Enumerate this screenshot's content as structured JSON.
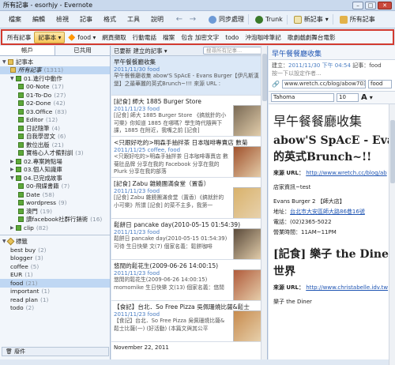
{
  "window": {
    "title": "所有記事 - esorhjy - Evernote"
  },
  "menu": {
    "items": [
      "檔案",
      "編輯",
      "檢視",
      "記事",
      "格式",
      "工具",
      "說明"
    ]
  },
  "toolbar": {
    "sync": "同步處理",
    "trunk": "Trunk",
    "new_note": "新記事",
    "all_notes": "所有記事"
  },
  "tag_filter": {
    "items": [
      "所有記事",
      "記事本",
      "food",
      "網頁擷取",
      "行動電話",
      "檔案",
      "包含 加密文字",
      "todo",
      "沖泡咖啡筆記",
      "歌劇戲劇舞台電影"
    ],
    "selected": "記事本"
  },
  "sidebar": {
    "tabs": [
      "帳戶",
      "已共用"
    ],
    "notebooks_header": "記事本",
    "all_notes": "所有記事",
    "all_count": "(1311)",
    "items": [
      {
        "label": "01.進行中動作",
        "level": 0,
        "expand": "▼"
      },
      {
        "label": "00-Note",
        "count": "(17)",
        "level": 1
      },
      {
        "label": "01-To-Do",
        "count": "(27)",
        "level": 1
      },
      {
        "label": "02-Done",
        "count": "(42)",
        "level": 1
      },
      {
        "label": "03.Office",
        "count": "(83)",
        "level": 1
      },
      {
        "label": "Editor",
        "count": "(12)",
        "level": 1
      },
      {
        "label": "日記隨筆",
        "count": "(4)",
        "level": 1
      },
      {
        "label": "自我學習文",
        "count": "(6)",
        "level": 1
      },
      {
        "label": "數位出版",
        "count": "(21)",
        "level": 1
      },
      {
        "label": "寶格心人才備對訓",
        "count": "(3)",
        "level": 1
      },
      {
        "label": "02.專案跨點場",
        "level": 0,
        "expand": "▶"
      },
      {
        "label": "03.個人知識庫",
        "level": 0,
        "expand": "▶"
      },
      {
        "label": "04.已完成故事",
        "level": 0,
        "expand": "▼"
      },
      {
        "label": "00-飛媒書籍",
        "count": "(7)",
        "level": 1
      },
      {
        "label": "Date",
        "count": "(58)",
        "level": 1
      },
      {
        "label": "wordpress",
        "count": "(9)",
        "level": 1
      },
      {
        "label": "澳門",
        "count": "(19)",
        "level": 1
      },
      {
        "label": "讀facebook社群行銷術",
        "count": "(16)",
        "level": 1
      },
      {
        "label": "clip",
        "count": "(82)",
        "level": 0,
        "expand": "▶"
      }
    ],
    "tags_header": "標籤",
    "tags": [
      {
        "label": "best buy",
        "count": "(2)"
      },
      {
        "label": "blogger",
        "count": "(3)"
      },
      {
        "label": "coffee",
        "count": "(5)"
      },
      {
        "label": "EUR",
        "count": "(1)"
      },
      {
        "label": "food",
        "count": "(21)"
      },
      {
        "label": "important",
        "count": "(1)"
      },
      {
        "label": "read plan",
        "count": "(1)"
      },
      {
        "label": "todo",
        "count": "(2)"
      }
    ],
    "trash": "廢件"
  },
  "note_list": {
    "sort": "已要新 建立的記事 ▾",
    "search_placeholder": "搜尋所有記事...",
    "notes": [
      {
        "title": "早午餐餐廳收集",
        "date": "2011/11/30",
        "tag": "food",
        "snippet": "早午餐餐廳收集 abow'S SpAcE - Evans Burger【伊凡斯漢堡】之最華麗的英式Brunch~!!! 來源 URL :"
      },
      {
        "title": "[記食] 師大 1885 Burger Store",
        "date": "2011/11/23",
        "tag": "food",
        "snippet": "[記食] 師大 1885 Burger Store 《搞就針的小可樂》你知道 1885 在哪嗎？學生時代隨興下課，1885 在附近，我嘴之前 [記食]",
        "thumb": true
      },
      {
        "title": "<只跟好吃的>明森手抽拌茶 日本咖啡專賣店 數菊",
        "date": "2011/11/25",
        "tag": "coffee, food",
        "snippet": "<只跟好吃的>明森手抽拌茶 日本咖啡專賣店 數菊肚品牌 分享在我的 Facebook 分享在我的Plurk 分享在我的部落",
        "thumb": true
      },
      {
        "title": "[記食] Zabu 雜饒團滿食堂（置香）",
        "date": "2011/11/23",
        "tag": "food",
        "snippet": "[記食] Zabu 雜饒團滿食堂（置香）《搞就針的小可樂》所謂 [記食] 的菜不主多，我第一",
        "thumb": true
      },
      {
        "title": "鬆餅日 pancake day(2010-05-15 01:54:39)",
        "date": "2011/11/23",
        "tag": "food",
        "snippet": "鬆餅日 pancake day(2010-05-15 01:54:39) 可待 生日快樂 文(7) 個家名義：鬆餅咖啡",
        "thumb": true
      },
      {
        "title": "悠閒的鬆花生(2009-06-26 14:00:15)",
        "date": "2011/11/23",
        "tag": "food",
        "snippet": "悠閒的鬆花生(2009-06-26 14:00:15) momomike 生日快樂 文(13) 個家名義：悠閒",
        "thumb": true
      },
      {
        "title": "【食記】台北．So Free Pizza 吳佩珊燒比薩&鬆士",
        "date": "2011/11/23",
        "tag": "food",
        "snippet": "【食記】台北．So Free Pizza 吳佩珊燒比薩&鬆士比薩(一) (好活動) (本篇文與其公平",
        "thumb": true
      }
    ],
    "footer_date": "November 22, 2011"
  },
  "note_view": {
    "title": "早午餐餐廳收集",
    "created_label": "建立：",
    "created": "2011/11/30 下午 04:54",
    "notebook_label": "記事：",
    "notebook": "food",
    "tag_placeholder": "按一下以設定作者...",
    "url": "www.wretch.cc/blog/abow703...",
    "tag_field": "food",
    "font": "Tahoma",
    "size": "10",
    "content": {
      "h1": "早午餐餐廳收集",
      "h2": "abow'S SpAcE - Evans",
      "h2b": "的英式Brunch~!!",
      "src_label": "來源 URL：",
      "src_url": "http://www.wretch.cc/blog/ab",
      "p1": "店家資訊~test",
      "p2": "Evans Burger 2 【師大店】",
      "addr_label": "地址：",
      "addr": "台北市大安區師大路86巷16號",
      "tel": "電話：(02)2365-5022",
      "hours": "營業時間：11AM~11PM",
      "h3": "[記食] 樂子 the Dine",
      "h3b": "世界",
      "src2_label": "來源 URL：",
      "src2_url": "http://www.christabelle.idv.tw",
      "p3": "樂子 the Diner"
    }
  }
}
